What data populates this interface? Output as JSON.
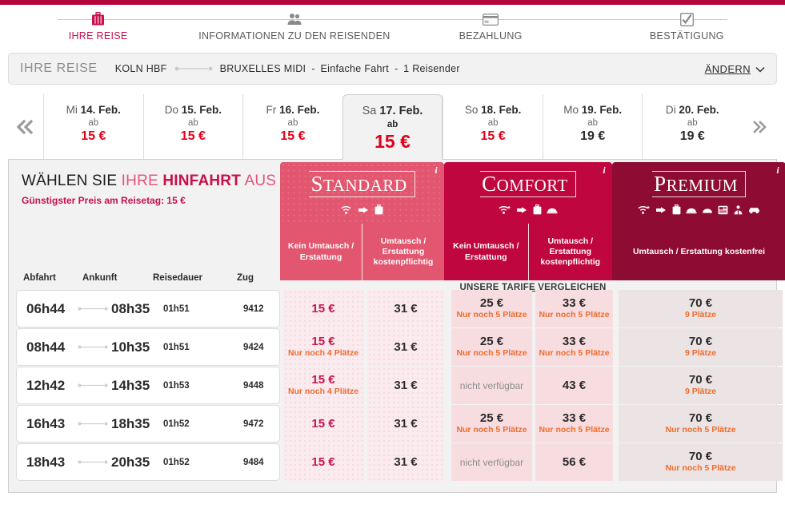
{
  "theme": {
    "brand_red": "#b3053a",
    "accent_pink": "#c8104a",
    "standard_bg": "#e2566f",
    "comfort_bg": "#c0063f",
    "premium_bg": "#8e0b33",
    "price_red": "#e2001a",
    "avail_orange": "#ef6c2b"
  },
  "stepper": {
    "steps": [
      {
        "label": "IHRE REISE",
        "icon": "suitcase-icon",
        "active": true
      },
      {
        "label": "INFORMATIONEN ZU DEN REISENDEN",
        "icon": "travellers-icon",
        "active": false
      },
      {
        "label": "BEZAHLUNG",
        "icon": "credit-card-icon",
        "active": false
      },
      {
        "label": "BESTÄTIGUNG",
        "icon": "checkbox-check-icon",
        "active": false
      }
    ]
  },
  "summary": {
    "title": "IHRE REISE",
    "origin": "KOLN HBF",
    "destination": "BRUXELLES MIDI",
    "trip_type": "Einfache Fahrt",
    "passengers": "1 Reisender",
    "separator": "-",
    "change_label": "ÄNDERN",
    "change_icon": "chevron-down-icon"
  },
  "datebar": {
    "prev_icon": "double-chevron-left-icon",
    "next_icon": "double-chevron-right-icon",
    "ab_label": "ab",
    "days": [
      {
        "weekday": "Mi",
        "date": "14. Feb.",
        "price": "15 €",
        "selected": false,
        "cheap": true
      },
      {
        "weekday": "Do",
        "date": "15. Feb.",
        "price": "15 €",
        "selected": false,
        "cheap": true
      },
      {
        "weekday": "Fr",
        "date": "16. Feb.",
        "price": "15 €",
        "selected": false,
        "cheap": true
      },
      {
        "weekday": "Sa",
        "date": "17. Feb.",
        "price": "15 €",
        "selected": true,
        "cheap": true
      },
      {
        "weekday": "So",
        "date": "18. Feb.",
        "price": "15 €",
        "selected": false,
        "cheap": true
      },
      {
        "weekday": "Mo",
        "date": "19. Feb.",
        "price": "19 €",
        "selected": false,
        "cheap": false
      },
      {
        "weekday": "Di",
        "date": "20. Feb.",
        "price": "19 €",
        "selected": false,
        "cheap": false
      }
    ]
  },
  "panel": {
    "title_part1": "WÄHLEN SIE ",
    "title_part2": "IHRE ",
    "title_part3": "HINFAHRT",
    "title_part4": " AUS",
    "subtitle": "Günstigster Preis am Reisetag: 15 €",
    "compare_link": "UNSERE TARIFE VERGLEICHEN",
    "columns": {
      "departure": "Abfahrt",
      "arrival": "Ankunft",
      "duration": "Reisedauer",
      "train": "Zug"
    }
  },
  "fares": [
    {
      "name": "STANDARD",
      "info_icon": "info-icon",
      "amenities": [
        "wifi-icon",
        "power-plug-icon",
        "luggage-icon"
      ],
      "conditions": [
        "Kein Umtausch / Erstattung",
        "Umtausch / Erstattung kostenpflichtig"
      ]
    },
    {
      "name": "COMFORT",
      "info_icon": "info-icon",
      "amenities": [
        "wifi-plus-icon",
        "power-plug-icon",
        "luggage-icon",
        "meal-tray-icon"
      ],
      "conditions": [
        "Kein Umtausch / Erstattung",
        "Umtausch / Erstattung kostenpflichtig"
      ]
    },
    {
      "name": "PREMIUM",
      "info_icon": "info-icon",
      "amenities": [
        "wifi-plus-icon",
        "power-plug-icon",
        "luggage-icon",
        "meal-tray-icon",
        "cloche-icon",
        "newspaper-icon",
        "lounge-icon",
        "taxi-icon"
      ],
      "conditions": [
        "Umtausch / Erstattung kostenfrei"
      ]
    }
  ],
  "unavailable_label": "nicht verfügbar",
  "trips": [
    {
      "departure": "06h44",
      "arrival": "08h35",
      "duration": "01h51",
      "train": "9412",
      "offers": [
        {
          "price": "15 €",
          "avail": "",
          "cheapest": true
        },
        {
          "price": "31 €",
          "avail": ""
        },
        {
          "price": "25 €",
          "avail": "Nur noch 5 Plätze"
        },
        {
          "price": "33 €",
          "avail": "Nur noch 5 Plätze"
        },
        {
          "price": "70 €",
          "avail": "9 Plätze"
        }
      ]
    },
    {
      "departure": "08h44",
      "arrival": "10h35",
      "duration": "01h51",
      "train": "9424",
      "offers": [
        {
          "price": "15 €",
          "avail": "Nur noch 4 Plätze",
          "cheapest": true
        },
        {
          "price": "31 €",
          "avail": ""
        },
        {
          "price": "25 €",
          "avail": "Nur noch 5 Plätze"
        },
        {
          "price": "33 €",
          "avail": "Nur noch 5 Plätze"
        },
        {
          "price": "70 €",
          "avail": "9 Plätze"
        }
      ]
    },
    {
      "departure": "12h42",
      "arrival": "14h35",
      "duration": "01h53",
      "train": "9448",
      "offers": [
        {
          "price": "15 €",
          "avail": "Nur noch 4 Plätze",
          "cheapest": true
        },
        {
          "price": "31 €",
          "avail": ""
        },
        {
          "price": "",
          "avail": "",
          "unavailable": true
        },
        {
          "price": "43 €",
          "avail": ""
        },
        {
          "price": "70 €",
          "avail": "9 Plätze"
        }
      ]
    },
    {
      "departure": "16h43",
      "arrival": "18h35",
      "duration": "01h52",
      "train": "9472",
      "offers": [
        {
          "price": "15 €",
          "avail": "",
          "cheapest": true
        },
        {
          "price": "31 €",
          "avail": ""
        },
        {
          "price": "25 €",
          "avail": "Nur noch 5 Plätze"
        },
        {
          "price": "33 €",
          "avail": "Nur noch 5 Plätze"
        },
        {
          "price": "70 €",
          "avail": "Nur noch 5 Plätze"
        }
      ]
    },
    {
      "departure": "18h43",
      "arrival": "20h35",
      "duration": "01h52",
      "train": "9484",
      "offers": [
        {
          "price": "15 €",
          "avail": "",
          "cheapest": true
        },
        {
          "price": "31 €",
          "avail": ""
        },
        {
          "price": "",
          "avail": "",
          "unavailable": true
        },
        {
          "price": "56 €",
          "avail": ""
        },
        {
          "price": "70 €",
          "avail": "Nur noch 5 Plätze"
        }
      ]
    }
  ]
}
